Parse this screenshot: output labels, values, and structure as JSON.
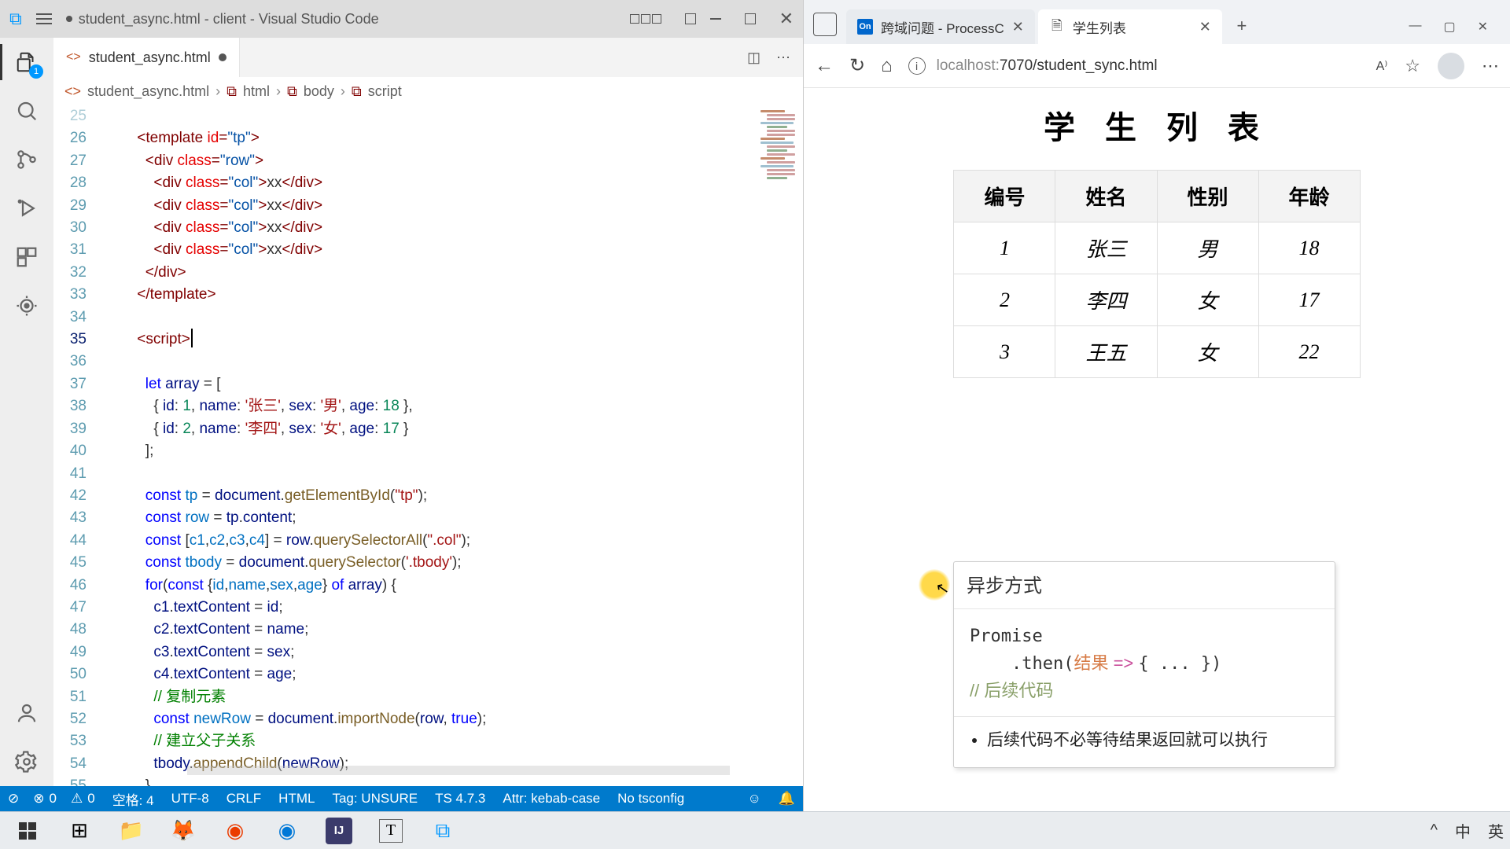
{
  "vscode": {
    "title": "student_async.html - client - Visual Studio Code",
    "tab_file": "student_async.html",
    "breadcrumb": [
      "student_async.html",
      "html",
      "body",
      "script"
    ],
    "explorer_badge": "1",
    "line_numbers_start": 26,
    "line_numbers_end": 55,
    "cursor_line": 35,
    "partial_top": "25",
    "statusbar": {
      "errors": "0",
      "warnings": "0",
      "spaces": "空格: 4",
      "encoding": "UTF-8",
      "eol": "CRLF",
      "lang": "HTML",
      "tag": "Tag: UNSURE",
      "ts": "TS 4.7.3",
      "attr": "Attr: kebab-case",
      "tsconfig": "No tsconfig"
    },
    "code_data": {
      "array_items": [
        {
          "id": 1,
          "name": "张三",
          "sex": "男",
          "age": 18
        },
        {
          "id": 2,
          "name": "李四",
          "sex": "女",
          "age": 17
        }
      ],
      "tp_id": "tp",
      "col_class": "col",
      "row_class": "row",
      "tbody_sel": ".tbody",
      "col_sel": ".col",
      "comment_copy": "复制元素",
      "comment_append": "建立父子关系"
    }
  },
  "browser": {
    "tabs": [
      {
        "fav": "On",
        "title": "跨域问题 - ProcessC",
        "active": false
      },
      {
        "fav": "doc",
        "title": "学生列表",
        "active": true
      }
    ],
    "addr_host": "localhost:",
    "addr_port_path": "7070/student_sync.html",
    "page_title": "学 生 列 表",
    "table_headers": [
      "编号",
      "姓名",
      "性别",
      "年龄"
    ],
    "table_rows": [
      [
        "1",
        "张三",
        "男",
        "18"
      ],
      [
        "2",
        "李四",
        "女",
        "17"
      ],
      [
        "3",
        "王五",
        "女",
        "22"
      ]
    ],
    "popup": {
      "title": "异步方式",
      "code_line1": "Promise",
      "code_line2_pre": "    .then(",
      "code_line2_var": "结果",
      "code_line2_arrow": " => ",
      "code_line2_post": "{ ... })",
      "code_line3": "// 后续代码",
      "bullet": "后续代码不必等待结果返回就可以执行"
    }
  },
  "taskbar": {
    "ime_lang": "英",
    "ime_eng": "中"
  }
}
